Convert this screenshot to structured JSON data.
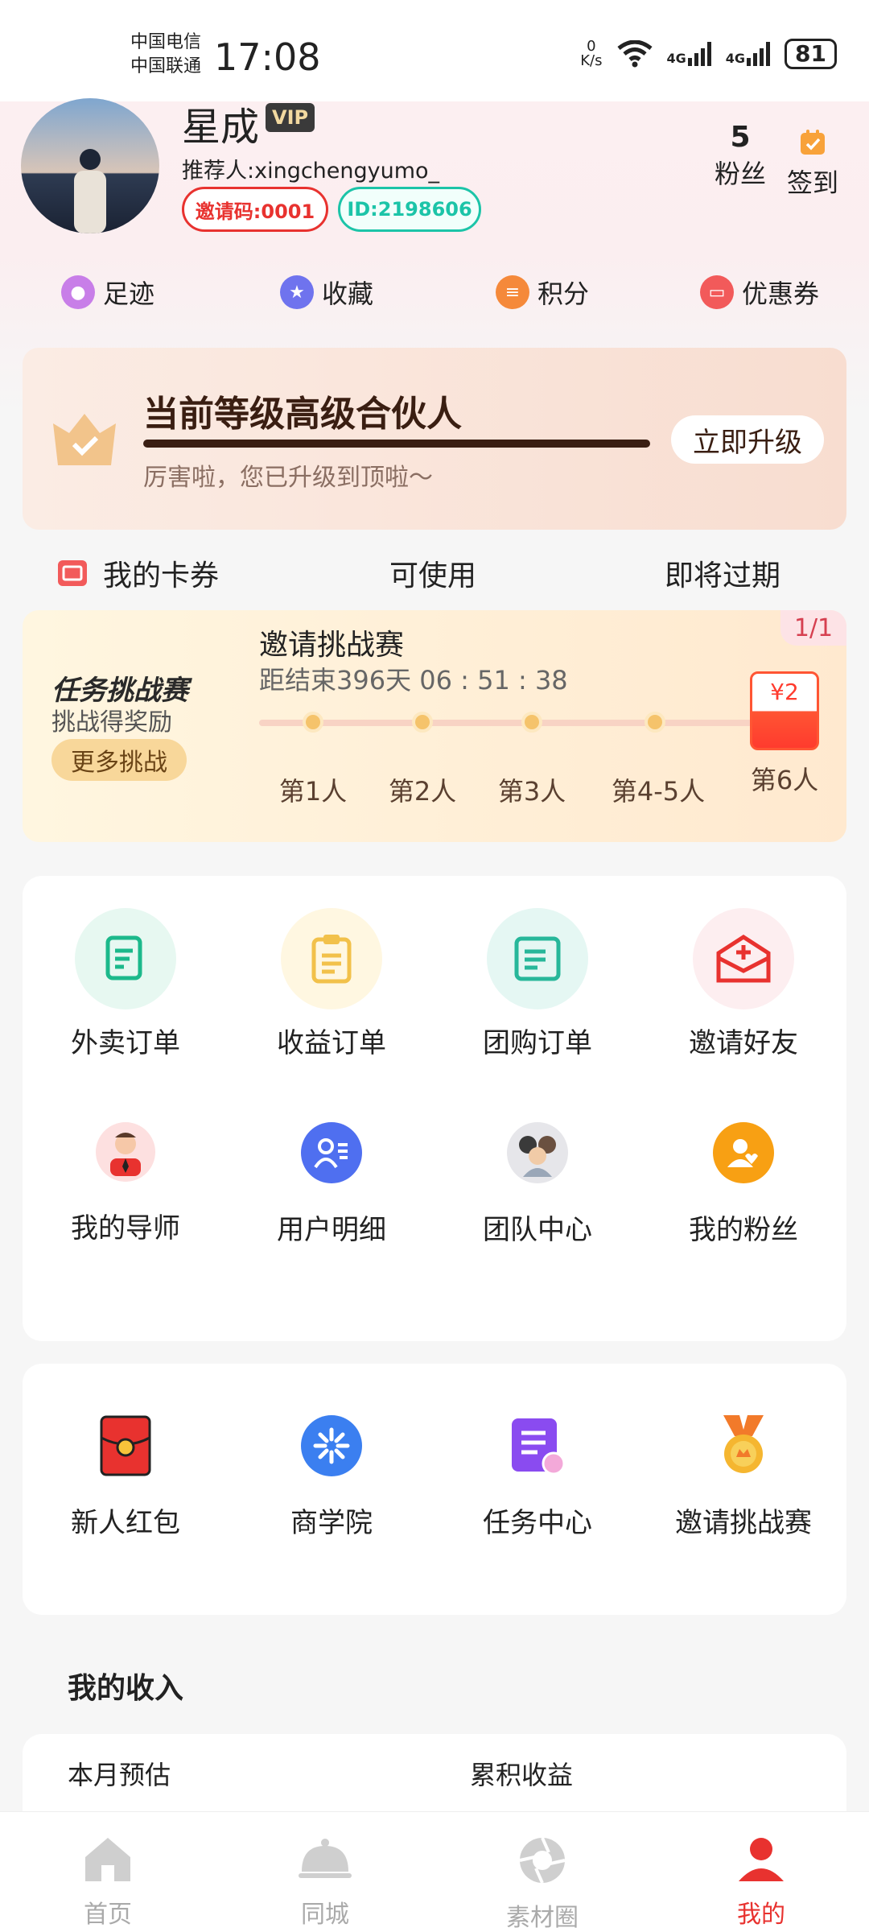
{
  "status_bar": {
    "carrier_1": "中国电信",
    "carrier_2": "中国联通",
    "time": "17:08",
    "net_speed_value": "0",
    "net_speed_unit": "K/s",
    "net_1": "4G",
    "net_2": "4G",
    "battery": "81"
  },
  "profile": {
    "name": "星成",
    "vip_label": "VIP",
    "referrer": "推荐人:xingchengyumo_",
    "invite_code": "邀请码:0001",
    "user_id": "ID:2198606",
    "fans_count": "5",
    "fans_label": "粉丝",
    "checkin_label": "签到"
  },
  "quick_links": [
    {
      "label": "足迹",
      "icon": "footprint-icon",
      "color": "#c87ee8"
    },
    {
      "label": "收藏",
      "icon": "star-icon",
      "color": "#6f73ee"
    },
    {
      "label": "积分",
      "icon": "coins-icon",
      "color": "#f5893a"
    },
    {
      "label": "优惠券",
      "icon": "ticket-icon",
      "color": "#f25a5a"
    }
  ],
  "level": {
    "title": "当前等级高级合伙人",
    "subtitle": "厉害啦，您已升级到顶啦～",
    "button": "立即升级"
  },
  "coupons": {
    "my_coupons": "我的卡券",
    "usable": "可使用",
    "expiring": "即将过期"
  },
  "challenge": {
    "logo_text": "任务挑战赛",
    "sub_text": "挑战得奖励",
    "more_button": "更多挑战",
    "title": "邀请挑战赛",
    "countdown": "距结束396天 06 : 51 : 38",
    "page": "1/1",
    "reward": "¥2",
    "steps": [
      "第1人",
      "第2人",
      "第3人",
      "第4-5人",
      "第6人"
    ]
  },
  "grid_1": [
    {
      "label": "外卖订单",
      "icon": "takeout-order-icon"
    },
    {
      "label": "收益订单",
      "icon": "earnings-order-icon"
    },
    {
      "label": "团购订单",
      "icon": "group-order-icon"
    },
    {
      "label": "邀请好友",
      "icon": "invite-friend-icon"
    },
    {
      "label": "我的导师",
      "icon": "mentor-icon"
    },
    {
      "label": "用户明细",
      "icon": "user-detail-icon"
    },
    {
      "label": "团队中心",
      "icon": "team-icon"
    },
    {
      "label": "我的粉丝",
      "icon": "fans-icon"
    }
  ],
  "grid_2": [
    {
      "label": "新人红包",
      "icon": "red-packet-icon"
    },
    {
      "label": "商学院",
      "icon": "academy-icon"
    },
    {
      "label": "任务中心",
      "icon": "task-center-icon"
    },
    {
      "label": "邀请挑战赛",
      "icon": "medal-icon"
    }
  ],
  "income": {
    "title": "我的收入",
    "month_estimate": "本月预估",
    "total_earnings": "累积收益"
  },
  "tabbar": [
    {
      "label": "首页",
      "icon": "home-icon",
      "active": false
    },
    {
      "label": "同城",
      "icon": "cloche-icon",
      "active": false
    },
    {
      "label": "素材圈",
      "icon": "aperture-icon",
      "active": false
    },
    {
      "label": "我的",
      "icon": "profile-icon",
      "active": true
    }
  ],
  "colors": {
    "accent_red": "#e8322f",
    "teal": "#1cc4a8",
    "level_dark": "#3a1e12"
  }
}
